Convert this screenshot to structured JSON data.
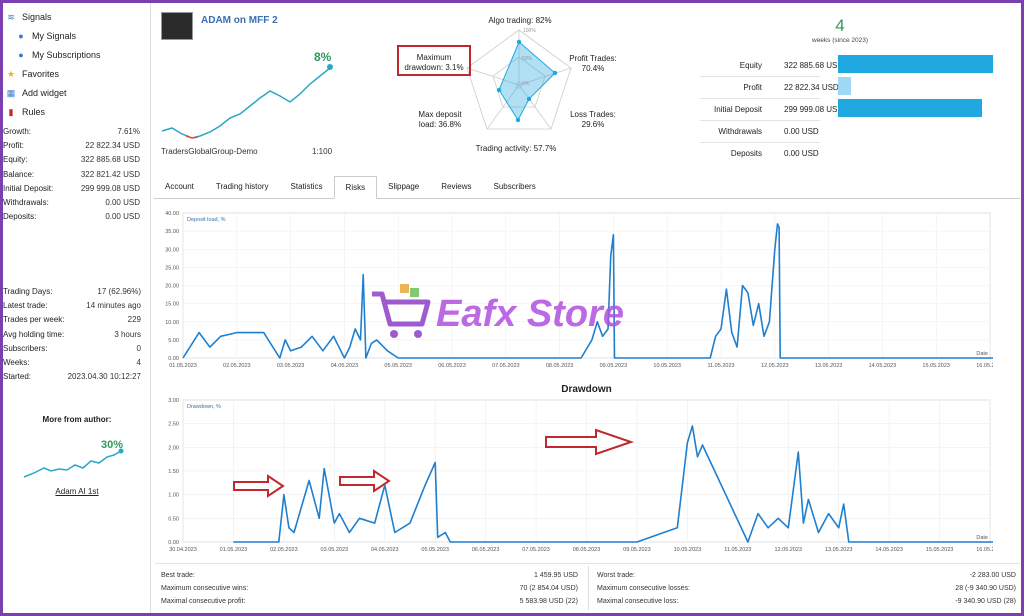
{
  "sidebar": {
    "nav": [
      {
        "label": "Signals",
        "icon": "signal-icon",
        "indent": false
      },
      {
        "label": "My Signals",
        "icon": "user-icon",
        "indent": true
      },
      {
        "label": "My Subscriptions",
        "icon": "user-icon",
        "indent": true
      },
      {
        "label": "Favorites",
        "icon": "star-icon",
        "indent": false
      },
      {
        "label": "Add widget",
        "icon": "widget-icon",
        "indent": false
      },
      {
        "label": "Rules",
        "icon": "bookmark-icon",
        "indent": false
      }
    ],
    "stats1": [
      {
        "k": "Growth:",
        "v": "7.61%"
      },
      {
        "k": "Profit:",
        "v": "22 822.34 USD"
      },
      {
        "k": "Equity:",
        "v": "322 885.68 USD"
      },
      {
        "k": "Balance:",
        "v": "322 821.42 USD"
      },
      {
        "k": "Initial Deposit:",
        "v": "299 999.08 USD"
      },
      {
        "k": "Withdrawals:",
        "v": "0.00 USD"
      },
      {
        "k": "Deposits:",
        "v": "0.00 USD"
      }
    ],
    "stats2": [
      {
        "k": "Trading Days:",
        "v": "17 (62.96%)"
      },
      {
        "k": "Latest trade:",
        "v": "14 minutes ago"
      },
      {
        "k": "Trades per week:",
        "v": "229"
      },
      {
        "k": "Avg holding time:",
        "v": "3 hours"
      },
      {
        "k": "Subscribers:",
        "v": "0"
      },
      {
        "k": "Weeks:",
        "v": "4"
      },
      {
        "k": "Started:",
        "v": "2023.04.30 10:12:27"
      }
    ],
    "more_title": "More from author:",
    "more_pct": "30%",
    "more_name": "Adam AI 1st"
  },
  "header": {
    "title": "ADAM on MFF 2",
    "growth_pct": "8%",
    "broker": "TradersGlobalGroup-Demo",
    "leverage": "1:100"
  },
  "radar": {
    "algo": "Algo trading: 82%",
    "profit_trades": "Profit Trades:",
    "profit_trades_v": "70.4%",
    "loss_trades": "Loss Trades:",
    "loss_trades_v": "29.6%",
    "activity": "Trading activity: 57.7%",
    "deposit_load": "Max deposit",
    "deposit_load2": "load: 36.8%",
    "max_dd": "Maximum",
    "max_dd2": "drawdown: 3.1%",
    "scale_100": "100%",
    "scale_50": "50%",
    "scale_0": "0%"
  },
  "weeks": {
    "num": "4",
    "label": "weeks (since 2023)"
  },
  "balance": [
    {
      "k": "Equity",
      "v": "322 885.68 USD",
      "fill": 0.86
    },
    {
      "k": "Profit",
      "v": "22 822.34 USD",
      "fill": 0.07
    },
    {
      "k": "Initial Deposit",
      "v": "299 999.08 USD",
      "fill": 0.8
    },
    {
      "k": "Withdrawals",
      "v": "0.00 USD",
      "fill": 0
    },
    {
      "k": "Deposits",
      "v": "0.00 USD",
      "fill": 0
    }
  ],
  "tabs": [
    "Account",
    "Trading history",
    "Statistics",
    "Risks",
    "Slippage",
    "Reviews",
    "Subscribers"
  ],
  "active_tab": "Risks",
  "chart_data": [
    {
      "type": "line",
      "title": "",
      "series_label": "Deposit load, %",
      "xlabel": "Date",
      "ylim": [
        0,
        40
      ],
      "yticks": [
        "40.00",
        "35.00",
        "30.00",
        "25.00",
        "20.00",
        "15.00",
        "10.00",
        "5.00",
        "0.00"
      ],
      "xticks": [
        "01.05.2023",
        "02.05.2023",
        "03.05.2023",
        "04.05.2023",
        "05.05.2023",
        "06.05.2023",
        "07.05.2023",
        "08.05.2023",
        "09.05.2023",
        "10.05.2023",
        "11.05.2023",
        "12.05.2023",
        "13.05.2023",
        "14.05.2023",
        "15.05.2023",
        "16.05.2023"
      ],
      "x": [
        0.0,
        0.3,
        0.5,
        0.7,
        1.0,
        1.5,
        1.8,
        1.9,
        2.0,
        2.2,
        2.4,
        2.6,
        2.8,
        3.0,
        3.1,
        3.2,
        3.3,
        3.35,
        3.4,
        3.5,
        3.6,
        3.8,
        4.0,
        6.0,
        7.4,
        7.6,
        7.7,
        7.8,
        7.9,
        7.95,
        8.0,
        8.02,
        8.5,
        9.0,
        9.5,
        9.8,
        9.9,
        10.0,
        10.1,
        10.2,
        10.3,
        10.4,
        10.5,
        10.6,
        10.7,
        10.8,
        10.9,
        11.0,
        11.05,
        11.08,
        11.1,
        11.2,
        13.0,
        15.0,
        15.3,
        15.4,
        15.5
      ],
      "values": [
        0,
        7,
        3,
        6,
        7,
        7,
        0,
        5,
        2,
        3,
        6,
        2,
        6,
        0,
        3,
        8,
        5,
        23,
        0,
        4,
        5,
        2,
        0,
        0,
        0,
        5,
        10,
        6,
        8,
        28,
        34,
        0,
        0,
        0,
        0,
        0,
        6,
        8,
        19,
        7,
        3,
        20,
        18,
        9,
        15,
        6,
        10,
        30,
        37,
        36,
        0,
        0,
        0,
        0,
        0,
        4,
        0
      ]
    },
    {
      "type": "line",
      "title": "Drawdown",
      "series_label": "Drawdown, %",
      "xlabel": "Date",
      "ylim": [
        0,
        3
      ],
      "yticks": [
        "3.00",
        "2.50",
        "2.00",
        "1.50",
        "1.00",
        "0.50",
        "0.00"
      ],
      "xticks": [
        "30.04.2023",
        "01.05.2023",
        "02.05.2023",
        "03.05.2023",
        "04.05.2023",
        "05.05.2023",
        "06.05.2023",
        "07.05.2023",
        "08.05.2023",
        "09.05.2023",
        "10.05.2023",
        "11.05.2023",
        "12.05.2023",
        "13.05.2023",
        "14.05.2023",
        "15.05.2023",
        "16.05.2023"
      ],
      "x": [
        0.0,
        0.9,
        1.0,
        1.1,
        1.2,
        1.5,
        1.7,
        1.8,
        2.0,
        2.1,
        2.3,
        2.5,
        2.8,
        3.0,
        3.2,
        3.5,
        3.8,
        4.0,
        4.05,
        4.2,
        4.3,
        4.5,
        5.0,
        8.0,
        8.8,
        9.0,
        9.1,
        9.2,
        9.3,
        10.2,
        10.4,
        10.6,
        10.8,
        11.0,
        11.2,
        11.3,
        11.4,
        11.6,
        11.8,
        12.0,
        12.1,
        12.2,
        14.0,
        15.5,
        15.7,
        15.8
      ],
      "values": [
        0,
        0,
        1.0,
        0.3,
        0.2,
        1.3,
        0.5,
        1.55,
        0.4,
        0.6,
        0.2,
        0.5,
        0.4,
        1.2,
        0.2,
        0.4,
        1.2,
        1.68,
        0.1,
        0.2,
        0,
        0,
        0,
        0,
        0.3,
        2.1,
        2.45,
        1.8,
        2.05,
        0,
        0.6,
        0.3,
        0.5,
        0.3,
        1.9,
        0.4,
        0.9,
        0.2,
        0.6,
        0.3,
        0.8,
        0,
        0,
        0,
        0.4,
        0
      ]
    }
  ],
  "bottom": {
    "left": [
      {
        "k": "Best trade:",
        "v": "1 459.95 USD"
      },
      {
        "k": "Maximum consecutive wins:",
        "v": "70 (2 854.04 USD)"
      },
      {
        "k": "Maximal consecutive profit:",
        "v": "5 583.98 USD (22)"
      }
    ],
    "right": [
      {
        "k": "Worst trade:",
        "v": "-2 283.00 USD"
      },
      {
        "k": "Maximum consecutive losses:",
        "v": "28 (-9 340.90 USD)"
      },
      {
        "k": "Maximal consecutive loss:",
        "v": "-9 340.90 USD (28)"
      }
    ]
  },
  "watermark": "Eafx Store",
  "colors": {
    "line": "#1f7fcf",
    "accent_green": "#2e9a5a",
    "bar": "#1fa7e0",
    "annotation_red": "#c0282d",
    "frame": "#7a3fb0"
  }
}
